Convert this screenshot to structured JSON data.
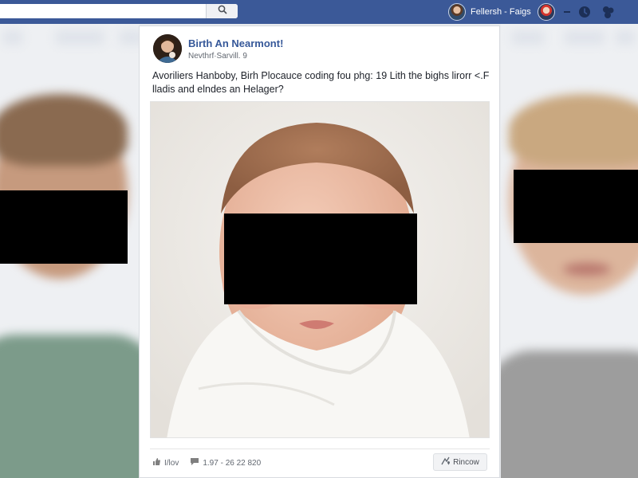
{
  "topbar": {
    "search_placeholder": "",
    "profile_name": "Fellersh - Faigs",
    "icons": [
      "search-icon",
      "friends-icon",
      "messages-icon",
      "notifications-icon"
    ]
  },
  "post": {
    "title": "Birth An Nearmont!",
    "subtitle": "Nevthrf·Sarvill. 9",
    "text": "Avoriliers Hanboby, Birh Plocauce coding fou phg: 19 Lith the bighs lirorr <.F lladis and elndes an Helager?",
    "footer": {
      "like_label": "I/lov",
      "stats_label": "1.97 - 26 22 820",
      "share_label": "Rincow"
    }
  },
  "colors": {
    "topbar": "#3b5998",
    "link": "#365899",
    "background": "#e9ebee",
    "censor": "#000000"
  }
}
